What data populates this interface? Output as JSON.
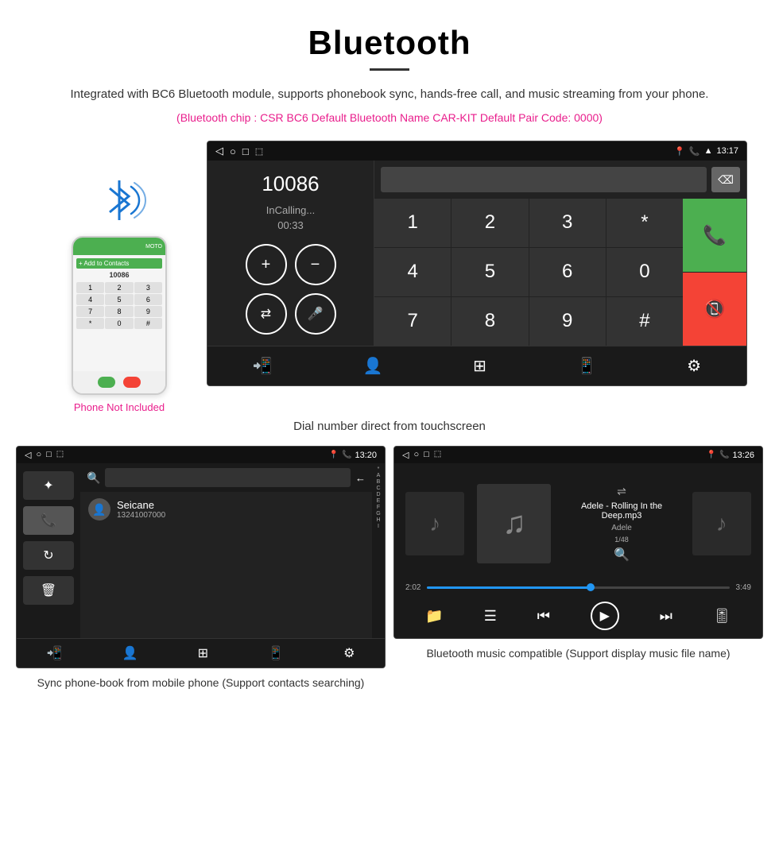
{
  "page": {
    "title": "Bluetooth",
    "description": "Integrated with BC6 Bluetooth module, supports phonebook sync, hands-free call, and music streaming from your phone.",
    "specs": "(Bluetooth chip : CSR BC6    Default Bluetooth Name CAR-KIT    Default Pair Code: 0000)",
    "phone_label": "Phone Not Included",
    "caption_main": "Dial number direct from touchscreen",
    "caption_phonebook": "Sync phone-book from mobile phone\n(Support contacts searching)",
    "caption_music": "Bluetooth music compatible\n(Support display music file name)"
  },
  "main_screen": {
    "status_time": "13:17",
    "dial_number": "10086",
    "in_calling": "InCalling...",
    "call_timer": "00:33",
    "numpad": [
      "1",
      "2",
      "3",
      "*",
      "4",
      "5",
      "6",
      "0",
      "7",
      "8",
      "9",
      "#"
    ]
  },
  "phonebook_screen": {
    "status_time": "13:20",
    "contact_name": "Seicane",
    "contact_phone": "13241007000",
    "alpha_list": [
      "*",
      "A",
      "B",
      "C",
      "D",
      "E",
      "F",
      "G",
      "H",
      "I"
    ]
  },
  "music_screen": {
    "status_time": "13:26",
    "track_title": "Adele - Rolling In the Deep.mp3",
    "artist": "Adele",
    "track_num": "1/48",
    "time_current": "2:02",
    "time_total": "3:49",
    "progress_pct": 54
  },
  "icons": {
    "bluetooth": "✦",
    "phone_call": "📞",
    "refresh": "↻",
    "trash": "🗑",
    "search": "🔍",
    "music": "♪",
    "volume_up": "🔊",
    "volume_down": "🔉",
    "transfer": "⇄",
    "mic": "🎤",
    "contacts": "👤",
    "keypad": "⊞",
    "settings": "⚙",
    "shuffle": "⇌",
    "prev": "⏮",
    "play": "▶",
    "pause": "⏸",
    "next": "⏭",
    "eq": "≡",
    "folder": "📁"
  }
}
